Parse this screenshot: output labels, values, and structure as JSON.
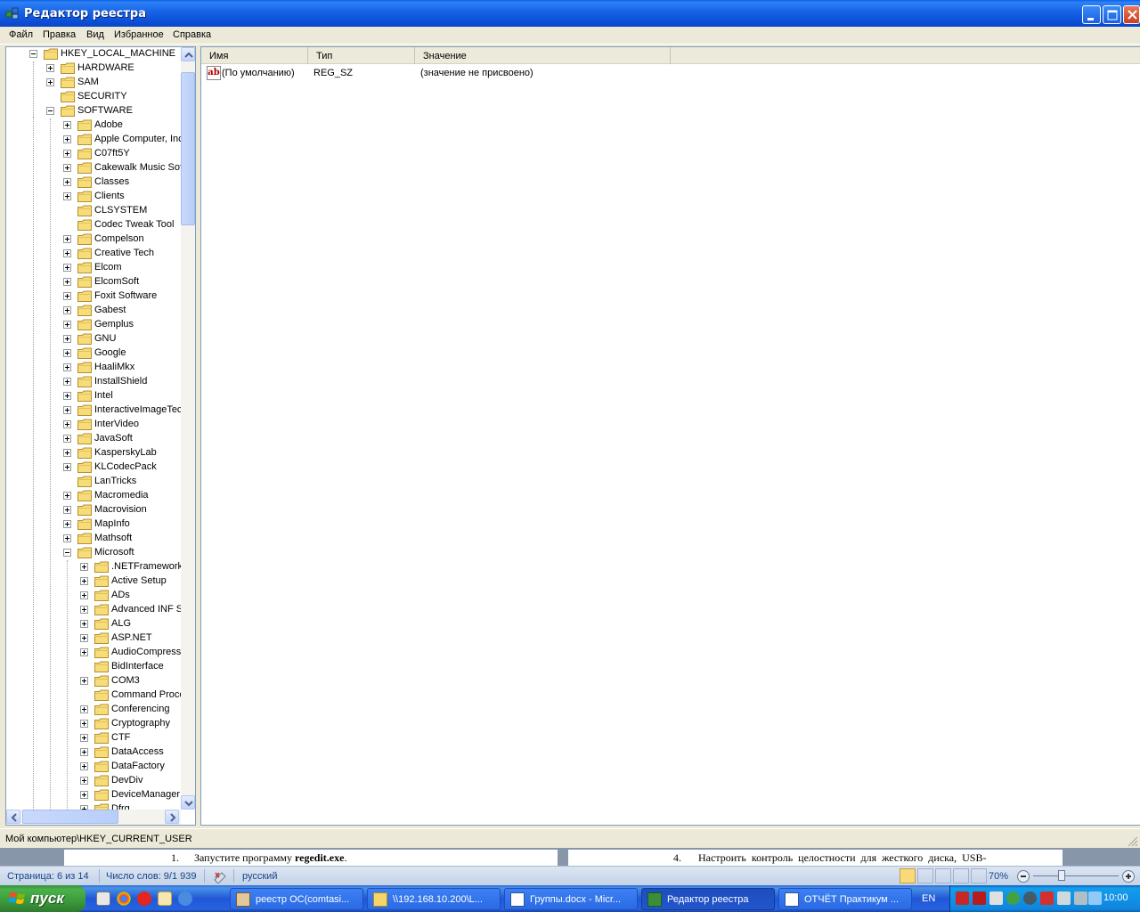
{
  "window": {
    "title": "Редактор реестра"
  },
  "menu": [
    "Файл",
    "Правка",
    "Вид",
    "Избранное",
    "Справка"
  ],
  "tree": {
    "items": [
      {
        "label": "HKEY_LOCAL_MACHINE",
        "level": 0,
        "expander": "minus"
      },
      {
        "label": "HARDWARE",
        "level": 1,
        "expander": "plus"
      },
      {
        "label": "SAM",
        "level": 1,
        "expander": "plus"
      },
      {
        "label": "SECURITY",
        "level": 1,
        "expander": "none"
      },
      {
        "label": "SOFTWARE",
        "level": 1,
        "expander": "minus"
      },
      {
        "label": "Adobe",
        "level": 2,
        "expander": "plus"
      },
      {
        "label": "Apple Computer, Inc.",
        "level": 2,
        "expander": "plus"
      },
      {
        "label": "C07ft5Y",
        "level": 2,
        "expander": "plus"
      },
      {
        "label": "Cakewalk Music Software",
        "level": 2,
        "expander": "plus"
      },
      {
        "label": "Classes",
        "level": 2,
        "expander": "plus"
      },
      {
        "label": "Clients",
        "level": 2,
        "expander": "plus"
      },
      {
        "label": "CLSYSTEM",
        "level": 2,
        "expander": "none"
      },
      {
        "label": "Codec Tweak Tool",
        "level": 2,
        "expander": "none"
      },
      {
        "label": "Compelson",
        "level": 2,
        "expander": "plus"
      },
      {
        "label": "Creative Tech",
        "level": 2,
        "expander": "plus"
      },
      {
        "label": "Elcom",
        "level": 2,
        "expander": "plus"
      },
      {
        "label": "ElcomSoft",
        "level": 2,
        "expander": "plus"
      },
      {
        "label": "Foxit Software",
        "level": 2,
        "expander": "plus"
      },
      {
        "label": "Gabest",
        "level": 2,
        "expander": "plus"
      },
      {
        "label": "Gemplus",
        "level": 2,
        "expander": "plus"
      },
      {
        "label": "GNU",
        "level": 2,
        "expander": "plus"
      },
      {
        "label": "Google",
        "level": 2,
        "expander": "plus"
      },
      {
        "label": "HaaliMkx",
        "level": 2,
        "expander": "plus"
      },
      {
        "label": "InstallShield",
        "level": 2,
        "expander": "plus"
      },
      {
        "label": "Intel",
        "level": 2,
        "expander": "plus"
      },
      {
        "label": "InteractiveImageTech",
        "level": 2,
        "expander": "plus"
      },
      {
        "label": "InterVideo",
        "level": 2,
        "expander": "plus"
      },
      {
        "label": "JavaSoft",
        "level": 2,
        "expander": "plus"
      },
      {
        "label": "KasperskyLab",
        "level": 2,
        "expander": "plus"
      },
      {
        "label": "KLCodecPack",
        "level": 2,
        "expander": "plus"
      },
      {
        "label": "LanTricks",
        "level": 2,
        "expander": "none"
      },
      {
        "label": "Macromedia",
        "level": 2,
        "expander": "plus"
      },
      {
        "label": "Macrovision",
        "level": 2,
        "expander": "plus"
      },
      {
        "label": "MapInfo",
        "level": 2,
        "expander": "plus"
      },
      {
        "label": "Mathsoft",
        "level": 2,
        "expander": "plus"
      },
      {
        "label": "Microsoft",
        "level": 2,
        "expander": "minus"
      },
      {
        "label": ".NETFramework",
        "level": 3,
        "expander": "plus"
      },
      {
        "label": "Active Setup",
        "level": 3,
        "expander": "plus"
      },
      {
        "label": "ADs",
        "level": 3,
        "expander": "plus"
      },
      {
        "label": "Advanced INF Setup",
        "level": 3,
        "expander": "plus"
      },
      {
        "label": "ALG",
        "level": 3,
        "expander": "plus"
      },
      {
        "label": "ASP.NET",
        "level": 3,
        "expander": "plus"
      },
      {
        "label": "AudioCompressionManager",
        "level": 3,
        "expander": "plus"
      },
      {
        "label": "BidInterface",
        "level": 3,
        "expander": "none"
      },
      {
        "label": "COM3",
        "level": 3,
        "expander": "plus"
      },
      {
        "label": "Command Processor",
        "level": 3,
        "expander": "none"
      },
      {
        "label": "Conferencing",
        "level": 3,
        "expander": "plus"
      },
      {
        "label": "Cryptography",
        "level": 3,
        "expander": "plus"
      },
      {
        "label": "CTF",
        "level": 3,
        "expander": "plus"
      },
      {
        "label": "DataAccess",
        "level": 3,
        "expander": "plus"
      },
      {
        "label": "DataFactory",
        "level": 3,
        "expander": "plus"
      },
      {
        "label": "DevDiv",
        "level": 3,
        "expander": "plus"
      },
      {
        "label": "DeviceManager",
        "level": 3,
        "expander": "plus"
      },
      {
        "label": "Dfrg",
        "level": 3,
        "expander": "plus"
      }
    ]
  },
  "list": {
    "columns": [
      "Имя",
      "Тип",
      "Значение"
    ],
    "rows": [
      {
        "name": "(По умолчанию)",
        "type": "REG_SZ",
        "value": "(значение не присвоено)",
        "icon": "string-value-icon"
      }
    ]
  },
  "status": {
    "path": "Мой компьютер\\HKEY_CURRENT_USER"
  },
  "document": {
    "left_num": "1.",
    "left_text_pre": "Запустите программу ",
    "left_text_bold": "regedit.exe",
    "left_text_post": ".",
    "right_num": "4.",
    "right_text": "Настроить  контроль  целостности  для  жесткого  диска,  USB-"
  },
  "word_status": {
    "page": "Страница: 6 из 14",
    "words": "Число слов: 9/1 939",
    "language": "русский",
    "zoom": "70%"
  },
  "taskbar": {
    "start_label": "пуск",
    "buttons": [
      {
        "label": "реестр ОС(comtasi...",
        "icon": "archive-icon",
        "active": false
      },
      {
        "label": "\\\\192.168.10.200\\L...",
        "icon": "folder-icon",
        "active": false
      },
      {
        "label": "Группы.docx - Micr...",
        "icon": "word-icon",
        "active": false
      },
      {
        "label": "Редактор реестра",
        "icon": "regedit-icon",
        "active": true
      },
      {
        "label": "ОТЧЁТ Практикум ...",
        "icon": "word-icon",
        "active": false
      }
    ],
    "language": "EN",
    "clock": "10:00"
  }
}
